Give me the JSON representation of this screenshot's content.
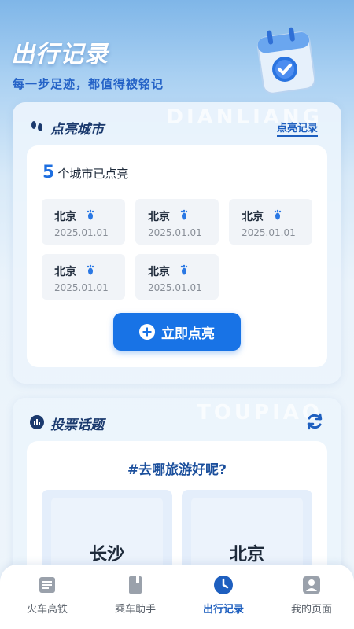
{
  "header": {
    "title": "出行记录",
    "subtitle": "每一步足迹，都值得被铭记"
  },
  "light_card": {
    "watermark": "DIANLIANG",
    "title": "点亮城市",
    "link_label": "点亮记录",
    "count": "5",
    "count_text": "个城市已点亮",
    "cities": [
      {
        "name": "北京",
        "date": "2025.01.01"
      },
      {
        "name": "北京",
        "date": "2025.01.01"
      },
      {
        "name": "北京",
        "date": "2025.01.01"
      },
      {
        "name": "北京",
        "date": "2025.01.01"
      },
      {
        "name": "北京",
        "date": "2025.01.01"
      }
    ],
    "button_label": "立即点亮"
  },
  "vote_card": {
    "watermark": "TOUPIAO",
    "title": "投票话题",
    "question": "#去哪旅游好呢?",
    "options": [
      {
        "label": "长沙"
      },
      {
        "label": "北京"
      }
    ]
  },
  "tabbar": {
    "tabs": [
      {
        "label": "火车高铁",
        "icon": "ticket-icon"
      },
      {
        "label": "乘车助手",
        "icon": "book-icon"
      },
      {
        "label": "出行记录",
        "icon": "clock-icon",
        "active": true
      },
      {
        "label": "我的页面",
        "icon": "profile-icon"
      }
    ]
  },
  "colors": {
    "primary": "#1873e6",
    "title_dark": "#1b3a6e",
    "accent_text": "#2563c7"
  }
}
